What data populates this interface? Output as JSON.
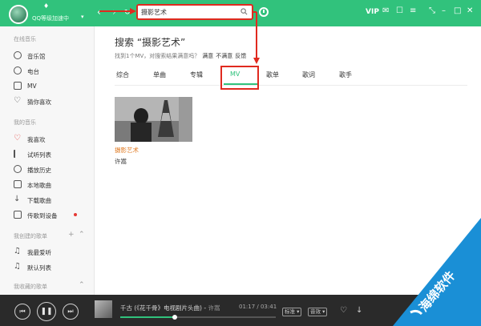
{
  "topbar": {
    "user_status": "QQ等级加速中",
    "search_value": "摄影艺术",
    "vip_label": "VIP",
    "icons": [
      "back-icon",
      "forward-icon",
      "refresh-icon",
      "skin-icon",
      "mail-icon",
      "shirt-icon",
      "settings-icon",
      "mini-mode-icon",
      "minimize-icon",
      "maximize-icon",
      "close-icon"
    ]
  },
  "sidebar": {
    "online_music_title": "在线音乐",
    "online_items": [
      {
        "label": "音乐馆",
        "icon": "music-hall-icon"
      },
      {
        "label": "电台",
        "icon": "radio-icon"
      },
      {
        "label": "MV",
        "icon": "mv-icon"
      },
      {
        "label": "猜你喜欢",
        "icon": "guess-like-icon"
      }
    ],
    "my_music_title": "我的音乐",
    "my_items": [
      {
        "label": "我喜欢",
        "icon": "heart-icon"
      },
      {
        "label": "试听列表",
        "icon": "list-icon"
      },
      {
        "label": "播放历史",
        "icon": "history-icon"
      },
      {
        "label": "本地歌曲",
        "icon": "local-icon"
      },
      {
        "label": "下载歌曲",
        "icon": "download-icon"
      },
      {
        "label": "传歌到设备",
        "icon": "device-icon"
      }
    ],
    "created_title": "我创建的歌单",
    "created_items": [
      {
        "label": "我最爱听",
        "icon": "playlist-icon"
      },
      {
        "label": "默认列表",
        "icon": "playlist-icon"
      }
    ],
    "collected_title": "我收藏的歌单"
  },
  "main": {
    "title": "搜索 “摄影艺术”",
    "result_text": "找到1个MV，对搜索结果满意吗？",
    "satisfied": "满意",
    "unsatisfied": "不满意",
    "feedback": "反馈",
    "tabs": [
      "综合",
      "单曲",
      "专辑",
      "MV",
      "歌单",
      "歌词",
      "歌手"
    ],
    "active_tab": "MV",
    "mv": {
      "title": "摄影艺术",
      "artist": "许嵩"
    }
  },
  "player": {
    "song": "千古 (《花千骨》电视剧片头曲)",
    "artist": "许嵩",
    "time": "01:17 / 03:41",
    "progress": 0.35,
    "quality_label": "标准",
    "sound_label": "音效",
    "icons": [
      "prev-icon",
      "pause-icon",
      "next-icon",
      "like-icon",
      "download-icon"
    ]
  },
  "watermark": {
    "text": "海绵软件"
  },
  "colors": {
    "accent": "#31c27c",
    "highlight": "#e02a1f",
    "mv_title": "#e07a22",
    "player_bg": "#2a2a2a"
  }
}
